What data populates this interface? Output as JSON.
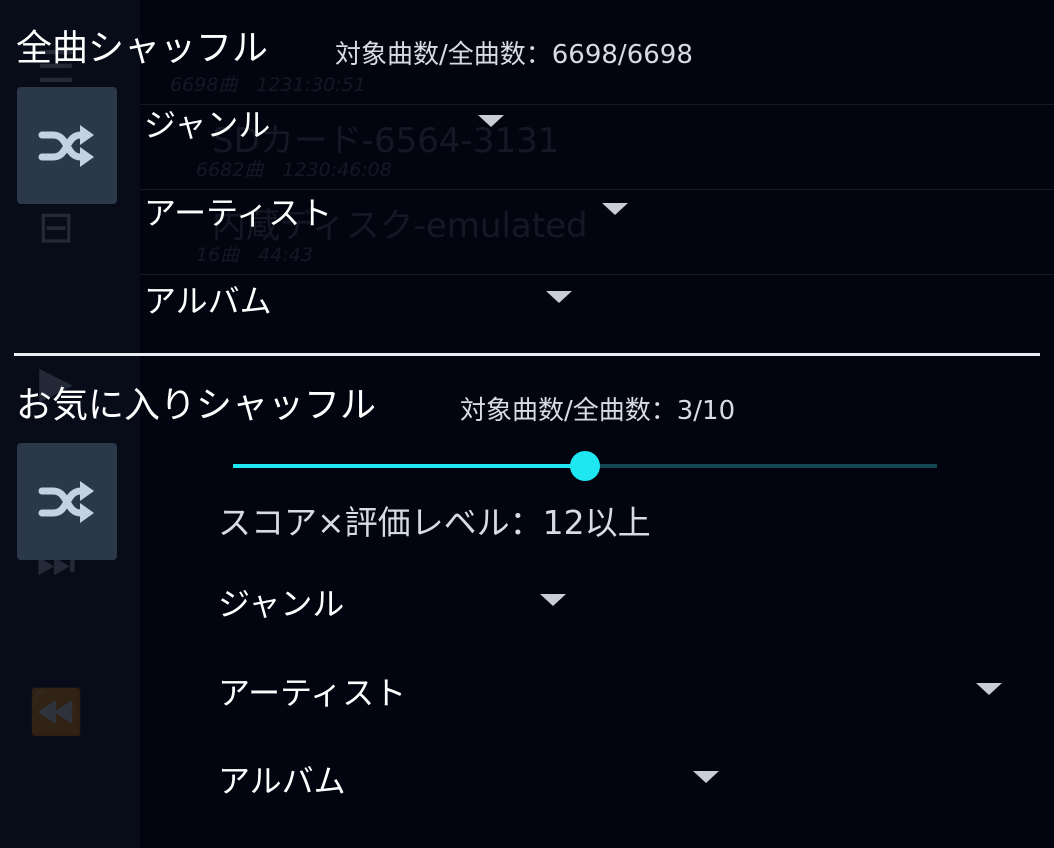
{
  "background": {
    "rows": [
      {
        "name": "",
        "meta": "6698曲　1231:30:51"
      },
      {
        "name": "SDカード-6564-3131",
        "meta": "6682曲　1230:46:08"
      },
      {
        "name": "内蔵ディスク-emulated",
        "meta": "16曲　44:43"
      }
    ]
  },
  "all_shuffle": {
    "title": "全曲シャッフル",
    "count_text": "対象曲数/全曲数：6698/6698",
    "button_icon": "shuffle-icon",
    "filters": {
      "genre": "ジャンル",
      "artist": "アーティスト",
      "album": "アルバム"
    }
  },
  "favorite_shuffle": {
    "title": "お気に入りシャッフル",
    "count_text": "対象曲数/全曲数：3/10",
    "button_icon": "shuffle-icon",
    "slider": {
      "value_fraction": 0.5
    },
    "score_text": "スコア×評価レベル：12以上",
    "filters": {
      "genre": "ジャンル",
      "artist": "アーティスト",
      "album": "アルバム"
    }
  },
  "colors": {
    "accent": "#1ee7f2",
    "button_bg": "#2b3849",
    "background": "#02040f"
  }
}
